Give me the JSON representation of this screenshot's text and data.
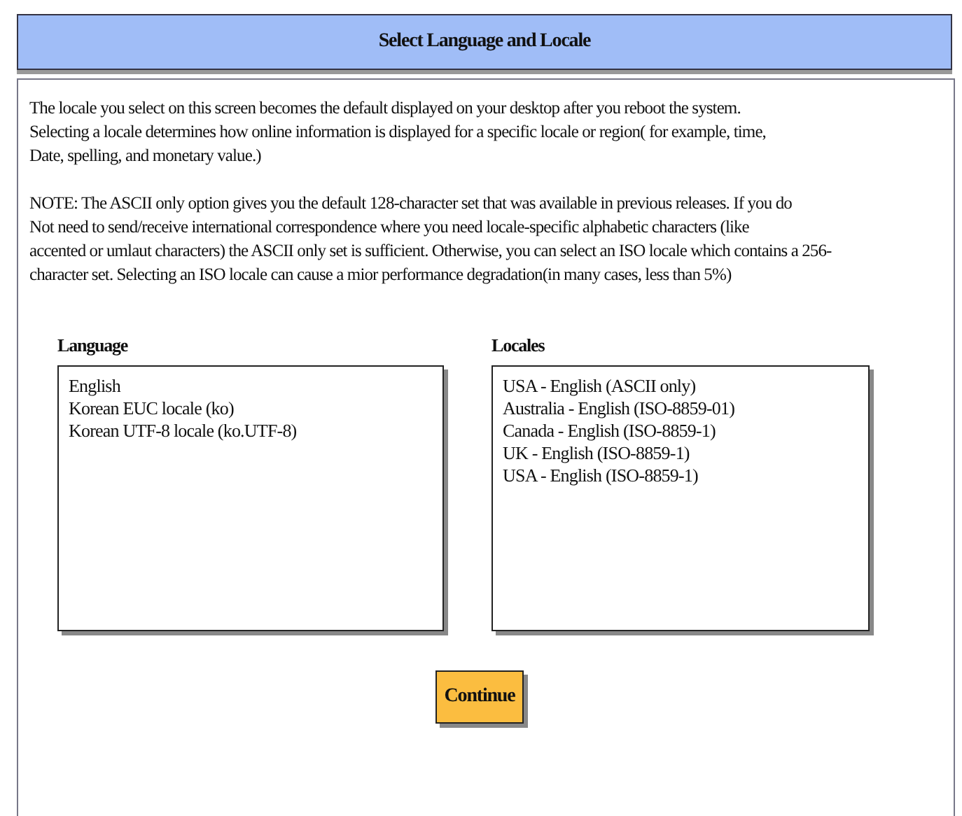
{
  "header": {
    "title": "Select Language and Locale"
  },
  "intro": [
    "The locale you select on this screen becomes the default displayed on your desktop after you reboot the system.",
    "Selecting a locale determines how online information is displayed for a specific locale or region( for example, time,",
    "Date, spelling, and monetary value.)"
  ],
  "note": [
    "NOTE: The ASCII only option gives you the default 128-character set that was available in previous releases. If you do",
    "Not need to send/receive international correspondence where you need locale-specific alphabetic characters (like",
    "accented or umlaut characters) the ASCII only set is sufficient. Otherwise, you can select an ISO locale which contains a 256-",
    "character set. Selecting an ISO locale can cause a mior performance degradation(in many cases, less than 5%)"
  ],
  "language": {
    "label": "Language",
    "items": [
      "English",
      "Korean EUC locale (ko)",
      "Korean UTF-8 locale (ko.UTF-8)"
    ]
  },
  "locales": {
    "label": "Locales",
    "items": [
      "USA - English (ASCII only)",
      "Australia - English (ISO-8859-01)",
      "Canada - English (ISO-8859-1)",
      "UK - English (ISO-8859-1)",
      "USA - English (ISO-8859-1)"
    ]
  },
  "button": "Continue"
}
